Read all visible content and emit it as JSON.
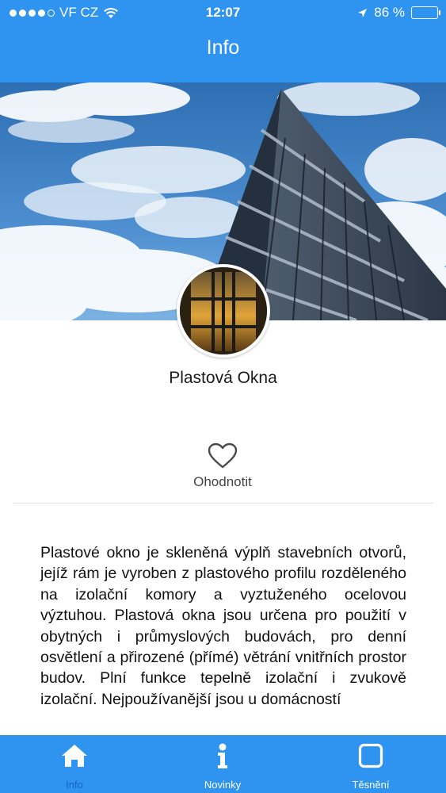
{
  "status_bar": {
    "carrier": "VF CZ",
    "time": "12:07",
    "battery": "86 %",
    "battery_level": 0.86
  },
  "nav": {
    "title": "Info"
  },
  "app": {
    "name": "Plastová Okna"
  },
  "rating": {
    "label": "Ohodnotit",
    "icon": "heart-outline"
  },
  "description": "Plastové okno je skleněná výplň stavebních otvorů, jejíž rám je vyroben z plastového profilu rozděleného na izolační komory a vyztuženého ocelovou výztuhou. Plastová okna jsou určena pro použití v obytných i průmyslových budovách, pro denní osvětlení a přirozené (přímé) větrání vnitřních prostor budov. Plní funkce tepelně izolační i zvukově izolační. Nejpoužívanější jsou u domácností",
  "tabs": [
    {
      "label": "Info",
      "icon": "home-icon",
      "active": true
    },
    {
      "label": "Novinky",
      "icon": "info-icon",
      "active": false
    },
    {
      "label": "Těsnění",
      "icon": "square-icon",
      "active": false
    }
  ],
  "colors": {
    "primary": "#2f93f0",
    "active_tab_label": "#1565c0"
  }
}
